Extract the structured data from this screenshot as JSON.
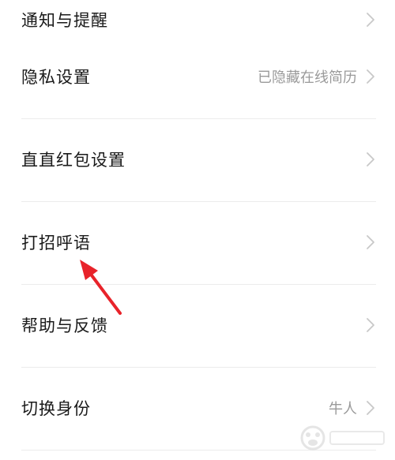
{
  "settings": {
    "items": [
      {
        "label": "通知与提醒",
        "value": ""
      },
      {
        "label": "隐私设置",
        "value": "已隐藏在线简历"
      },
      {
        "label": "直直红包设置",
        "value": ""
      },
      {
        "label": "打招呼语",
        "value": ""
      },
      {
        "label": "帮助与反馈",
        "value": ""
      },
      {
        "label": "切换身份",
        "value": "牛人"
      }
    ]
  },
  "icons": {
    "row_arrow": "chevron-right-icon",
    "annotation": "red-arrow-pointer-icon"
  },
  "colors": {
    "label_text": "#1a1a1a",
    "value_text": "#9a9a9a",
    "chevron": "#c8c8c8",
    "divider": "#ececec",
    "annotation_arrow": "#e8232a"
  }
}
